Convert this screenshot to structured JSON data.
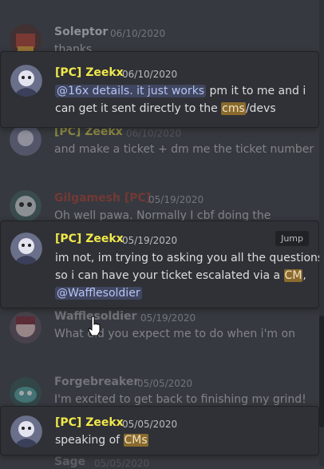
{
  "background_messages": [
    {
      "name": "Soleptor",
      "timestamp": "06/10/2020",
      "text": "thanks",
      "color": "#8e9297"
    },
    {
      "name": "[PC] Zeekx",
      "timestamp": "06/10/2020",
      "text": "and make a ticket + dm me the ticket number",
      "color": "#f1e84b"
    },
    {
      "name": "Gilgamesh [PC]",
      "timestamp": "05/19/2020",
      "text": "Oh well pawa. Normally I cbf doing the",
      "color": "#c0392b"
    },
    {
      "name": "Wafflesoldier",
      "timestamp": "05/19/2020",
      "text": "What did you expect me to do when i'm on",
      "color": "#8e9297"
    },
    {
      "name": "Forgebreaker",
      "timestamp": "05/05/2020",
      "text": "I'm excited to get back to finishing my grind!",
      "color": "#8e9297"
    },
    {
      "name": "Sage",
      "timestamp": "05/05/2020",
      "text": "",
      "color": "#8e9297"
    }
  ],
  "pinned": [
    {
      "name": "[PC] Zeekx",
      "timestamp": "06/10/2020",
      "line1": {
        "mention": "@16x details. it just works",
        "rest": " pm it to me and i"
      },
      "line2": {
        "before": "can get it sent directly to the ",
        "highlight": "cms",
        "after": "/devs"
      }
    },
    {
      "name": "[PC] Zeekx",
      "timestamp": "05/19/2020",
      "jump_label": "Jump",
      "line1": "im not, im trying to asking you all the questions",
      "line2": {
        "before": "so i can have your ticket escalated via a ",
        "highlight": "CM",
        "after": ","
      },
      "line3": {
        "mention": "@Wafflesoldier"
      }
    },
    {
      "name": "[PC] Zeekx",
      "timestamp": "05/05/2020",
      "line1": {
        "before": "speaking of ",
        "highlight": "CMs"
      }
    }
  ]
}
